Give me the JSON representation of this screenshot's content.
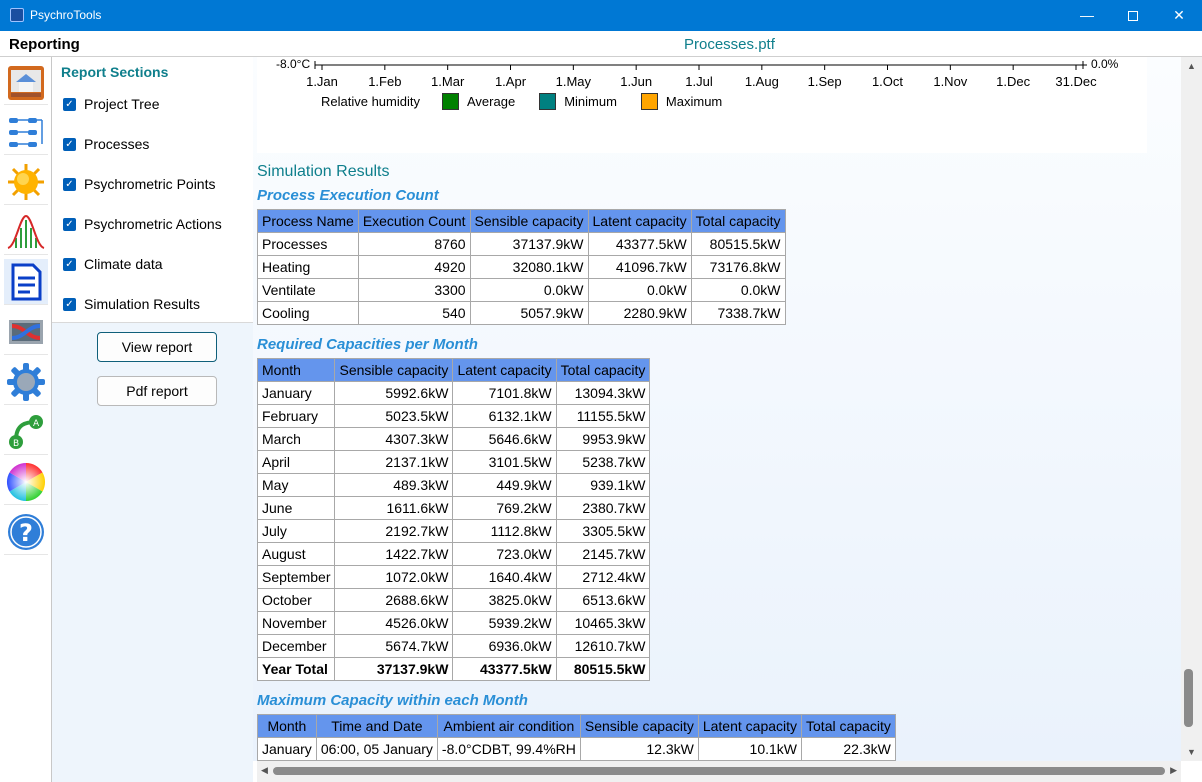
{
  "window": {
    "title": "PsychroTools",
    "minimize": "—",
    "close": "✕"
  },
  "header": {
    "section": "Reporting",
    "file": "Processes.ptf"
  },
  "rail": {
    "icons": [
      "house-icon",
      "flow-diagram-icon",
      "sun-icon",
      "distribution-chart-icon",
      "report-document-icon",
      "heat-exchanger-icon",
      "gear-icon",
      "ab-transition-icon",
      "color-wheel-icon",
      "help-icon"
    ]
  },
  "panel": {
    "title": "Report Sections",
    "items": [
      {
        "label": "Project Tree",
        "checked": true
      },
      {
        "label": "Processes",
        "checked": true
      },
      {
        "label": "Psychrometric Points",
        "checked": true
      },
      {
        "label": "Psychrometric Actions",
        "checked": true
      },
      {
        "label": "Climate data",
        "checked": true
      },
      {
        "label": "Simulation Results",
        "checked": true
      }
    ],
    "view_button": "View report",
    "pdf_button": "Pdf report"
  },
  "chart_data": {
    "type": "line",
    "x_ticks": [
      "1.Jan",
      "1.Feb",
      "1.Mar",
      "1.Apr",
      "1.May",
      "1.Jun",
      "1.Jul",
      "1.Aug",
      "1.Sep",
      "1.Oct",
      "1.Nov",
      "1.Dec",
      "31.Dec"
    ],
    "left_axis_label": "-8.0°C",
    "right_axis_label": "0.0%",
    "legend_title": "Relative humidity",
    "legend": [
      {
        "name": "Average",
        "color": "#008000"
      },
      {
        "name": "Minimum",
        "color": "#008080"
      },
      {
        "name": "Maximum",
        "color": "#ffa500"
      }
    ]
  },
  "results": {
    "title": "Simulation Results",
    "t1": {
      "title": "Process Execution Count",
      "headers": [
        "Process Name",
        "Execution Count",
        "Sensible capacity",
        "Latent capacity",
        "Total capacity"
      ],
      "rows": [
        [
          "Processes",
          "8760",
          "37137.9kW",
          "43377.5kW",
          "80515.5kW"
        ],
        [
          "Heating",
          "4920",
          "32080.1kW",
          "41096.7kW",
          "73176.8kW"
        ],
        [
          "Ventilate",
          "3300",
          "0.0kW",
          "0.0kW",
          "0.0kW"
        ],
        [
          "Cooling",
          "540",
          "5057.9kW",
          "2280.9kW",
          "7338.7kW"
        ]
      ]
    },
    "t2": {
      "title": "Required Capacities per Month",
      "headers": [
        "Month",
        "Sensible capacity",
        "Latent capacity",
        "Total capacity"
      ],
      "rows": [
        [
          "January",
          "5992.6kW",
          "7101.8kW",
          "13094.3kW"
        ],
        [
          "February",
          "5023.5kW",
          "6132.1kW",
          "11155.5kW"
        ],
        [
          "March",
          "4307.3kW",
          "5646.6kW",
          "9953.9kW"
        ],
        [
          "April",
          "2137.1kW",
          "3101.5kW",
          "5238.7kW"
        ],
        [
          "May",
          "489.3kW",
          "449.9kW",
          "939.1kW"
        ],
        [
          "June",
          "1611.6kW",
          "769.2kW",
          "2380.7kW"
        ],
        [
          "July",
          "2192.7kW",
          "1112.8kW",
          "3305.5kW"
        ],
        [
          "August",
          "1422.7kW",
          "723.0kW",
          "2145.7kW"
        ],
        [
          "September",
          "1072.0kW",
          "1640.4kW",
          "2712.4kW"
        ],
        [
          "October",
          "2688.6kW",
          "3825.0kW",
          "6513.6kW"
        ],
        [
          "November",
          "4526.0kW",
          "5939.2kW",
          "10465.3kW"
        ],
        [
          "December",
          "5674.7kW",
          "6936.0kW",
          "12610.7kW"
        ]
      ],
      "total": [
        "Year Total",
        "37137.9kW",
        "43377.5kW",
        "80515.5kW"
      ]
    },
    "t3": {
      "title": "Maximum Capacity within each Month",
      "headers": [
        "Month",
        "Time and Date",
        "Ambient air condition",
        "Sensible capacity",
        "Latent capacity",
        "Total capacity"
      ],
      "rows": [
        [
          "January",
          "06:00, 05 January",
          "-8.0°CDBT, 99.4%RH",
          "12.3kW",
          "10.1kW",
          "22.3kW"
        ]
      ]
    }
  }
}
